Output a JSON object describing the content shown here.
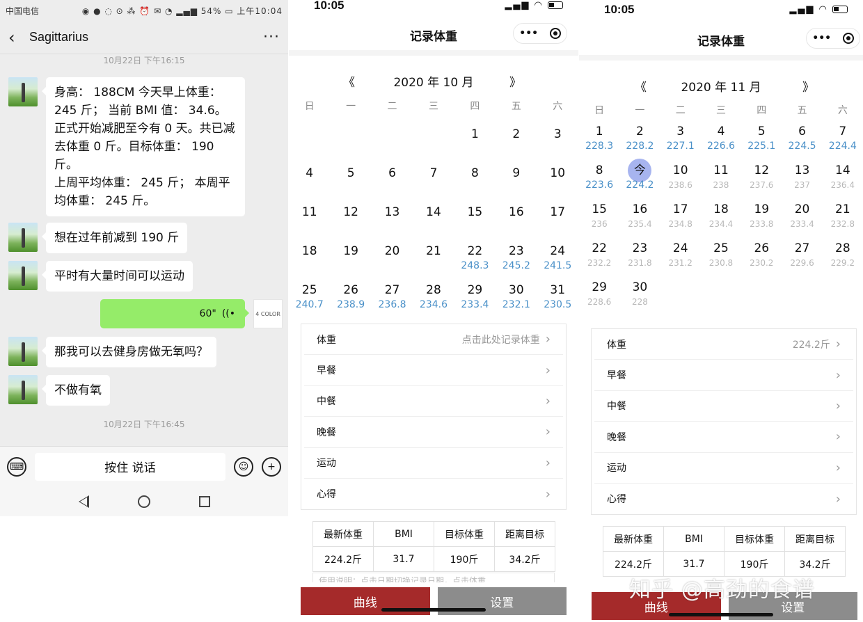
{
  "chat": {
    "status_left": "中国电信",
    "status_battery": "54%",
    "status_time": "上午10:04",
    "contact_name": "Sagittarius",
    "more": "···",
    "timestamp1": "10月22日 下午16:15",
    "timestamp2": "10月22日 下午16:45",
    "messages": [
      "身高： 188CM 今天早上体重： 245 斤； 当前 BMI 值： 34.6。 正式开始减肥至今有 0 天。共已减去体重 0 斤。目标体重： 190 斤。",
      "上周平均体重： 245 斤； 本周平均体重： 245 斤。",
      "想在过年前减到 190 斤",
      "平时有大量时间可以运动",
      "那我可以去健身房做无氧吗？",
      "不做有氧"
    ],
    "voice_duration": "60\"",
    "avatar_label": "4 COLOR",
    "hold_to_talk": "按住 说话"
  },
  "app_oct": {
    "time": "10:05",
    "title": "记录体重",
    "prev": "《",
    "next": "》",
    "year_month": "2020 年 10 月",
    "weekdays": [
      "日",
      "一",
      "二",
      "三",
      "四",
      "五",
      "六"
    ],
    "rows": [
      [
        {
          "d": "",
          "w": ""
        },
        {
          "d": "",
          "w": ""
        },
        {
          "d": "",
          "w": ""
        },
        {
          "d": "",
          "w": ""
        },
        {
          "d": "1",
          "w": ""
        },
        {
          "d": "2",
          "w": ""
        },
        {
          "d": "3",
          "w": ""
        }
      ],
      [
        {
          "d": "4",
          "w": ""
        },
        {
          "d": "5",
          "w": ""
        },
        {
          "d": "6",
          "w": ""
        },
        {
          "d": "7",
          "w": ""
        },
        {
          "d": "8",
          "w": ""
        },
        {
          "d": "9",
          "w": ""
        },
        {
          "d": "10",
          "w": ""
        }
      ],
      [
        {
          "d": "11",
          "w": ""
        },
        {
          "d": "12",
          "w": ""
        },
        {
          "d": "13",
          "w": ""
        },
        {
          "d": "14",
          "w": ""
        },
        {
          "d": "15",
          "w": ""
        },
        {
          "d": "16",
          "w": ""
        },
        {
          "d": "17",
          "w": ""
        }
      ],
      [
        {
          "d": "18",
          "w": ""
        },
        {
          "d": "19",
          "w": ""
        },
        {
          "d": "20",
          "w": ""
        },
        {
          "d": "21",
          "w": ""
        },
        {
          "d": "22",
          "w": "248.3"
        },
        {
          "d": "23",
          "w": "245.2"
        },
        {
          "d": "24",
          "w": "241.5"
        }
      ],
      [
        {
          "d": "25",
          "w": "240.7"
        },
        {
          "d": "26",
          "w": "238.9"
        },
        {
          "d": "27",
          "w": "236.8"
        },
        {
          "d": "28",
          "w": "234.6"
        },
        {
          "d": "29",
          "w": "233.4"
        },
        {
          "d": "30",
          "w": "232.1"
        },
        {
          "d": "31",
          "w": "230.5"
        }
      ]
    ],
    "form": [
      {
        "label": "体重",
        "value": "点击此处记录体重"
      },
      {
        "label": "早餐",
        "value": ""
      },
      {
        "label": "中餐",
        "value": ""
      },
      {
        "label": "晚餐",
        "value": ""
      },
      {
        "label": "运动",
        "value": ""
      },
      {
        "label": "心得",
        "value": ""
      }
    ],
    "stats_headers": [
      "最新体重",
      "BMI",
      "目标体重",
      "距离目标"
    ],
    "stats_values": [
      "224.2斤",
      "31.7",
      "190斤",
      "34.2斤"
    ],
    "usage_text": "使用说明：点击日期切换记录日期，点击体重",
    "btn_curve": "曲线",
    "btn_settings": "设置"
  },
  "app_nov": {
    "time": "10:05",
    "title": "记录体重",
    "prev": "《",
    "next": "》",
    "year_month": "2020 年 11 月",
    "weekdays": [
      "日",
      "一",
      "二",
      "三",
      "四",
      "五",
      "六"
    ],
    "rows": [
      [
        {
          "d": "1",
          "w": "228.3",
          "c": "blue"
        },
        {
          "d": "2",
          "w": "228.2",
          "c": "blue"
        },
        {
          "d": "3",
          "w": "227.1",
          "c": "blue"
        },
        {
          "d": "4",
          "w": "226.6",
          "c": "blue"
        },
        {
          "d": "5",
          "w": "225.1",
          "c": "blue"
        },
        {
          "d": "6",
          "w": "224.5",
          "c": "blue"
        },
        {
          "d": "7",
          "w": "224.4",
          "c": "blue"
        }
      ],
      [
        {
          "d": "8",
          "w": "223.6",
          "c": "blue"
        },
        {
          "d": "今",
          "w": "224.2",
          "c": "blue",
          "sel": true
        },
        {
          "d": "10",
          "w": "238.6",
          "c": "gray"
        },
        {
          "d": "11",
          "w": "238",
          "c": "gray"
        },
        {
          "d": "12",
          "w": "237.6",
          "c": "gray"
        },
        {
          "d": "13",
          "w": "237",
          "c": "gray"
        },
        {
          "d": "14",
          "w": "236.4",
          "c": "gray"
        }
      ],
      [
        {
          "d": "15",
          "w": "236",
          "c": "gray"
        },
        {
          "d": "16",
          "w": "235.4",
          "c": "gray"
        },
        {
          "d": "17",
          "w": "234.8",
          "c": "gray"
        },
        {
          "d": "18",
          "w": "234.4",
          "c": "gray"
        },
        {
          "d": "19",
          "w": "233.8",
          "c": "gray"
        },
        {
          "d": "20",
          "w": "233.4",
          "c": "gray"
        },
        {
          "d": "21",
          "w": "232.8",
          "c": "gray"
        }
      ],
      [
        {
          "d": "22",
          "w": "232.2",
          "c": "gray"
        },
        {
          "d": "23",
          "w": "231.8",
          "c": "gray"
        },
        {
          "d": "24",
          "w": "231.2",
          "c": "gray"
        },
        {
          "d": "25",
          "w": "230.8",
          "c": "gray"
        },
        {
          "d": "26",
          "w": "230.2",
          "c": "gray"
        },
        {
          "d": "27",
          "w": "229.6",
          "c": "gray"
        },
        {
          "d": "28",
          "w": "229.2",
          "c": "gray"
        }
      ],
      [
        {
          "d": "29",
          "w": "228.6",
          "c": "gray"
        },
        {
          "d": "30",
          "w": "228",
          "c": "gray"
        },
        {
          "d": "",
          "w": ""
        },
        {
          "d": "",
          "w": ""
        },
        {
          "d": "",
          "w": ""
        },
        {
          "d": "",
          "w": ""
        },
        {
          "d": "",
          "w": ""
        }
      ]
    ],
    "form": [
      {
        "label": "体重",
        "value": "224.2斤"
      },
      {
        "label": "早餐",
        "value": ""
      },
      {
        "label": "中餐",
        "value": ""
      },
      {
        "label": "晚餐",
        "value": ""
      },
      {
        "label": "运动",
        "value": ""
      },
      {
        "label": "心得",
        "value": ""
      }
    ],
    "stats_headers": [
      "最新体重",
      "BMI",
      "目标体重",
      "距离目标"
    ],
    "stats_values": [
      "224.2斤",
      "31.7",
      "190斤",
      "34.2斤"
    ],
    "btn_curve": "曲线",
    "btn_settings": "设置"
  },
  "watermark": "知乎 @高劲的食谱",
  "colors": {
    "blue_weight": "#4a90c8",
    "gray_weight": "#b8b8b8",
    "curve_btn": "#a52a2a",
    "settings_btn": "#8c8c8c",
    "voice_bubble": "#95ec69"
  }
}
